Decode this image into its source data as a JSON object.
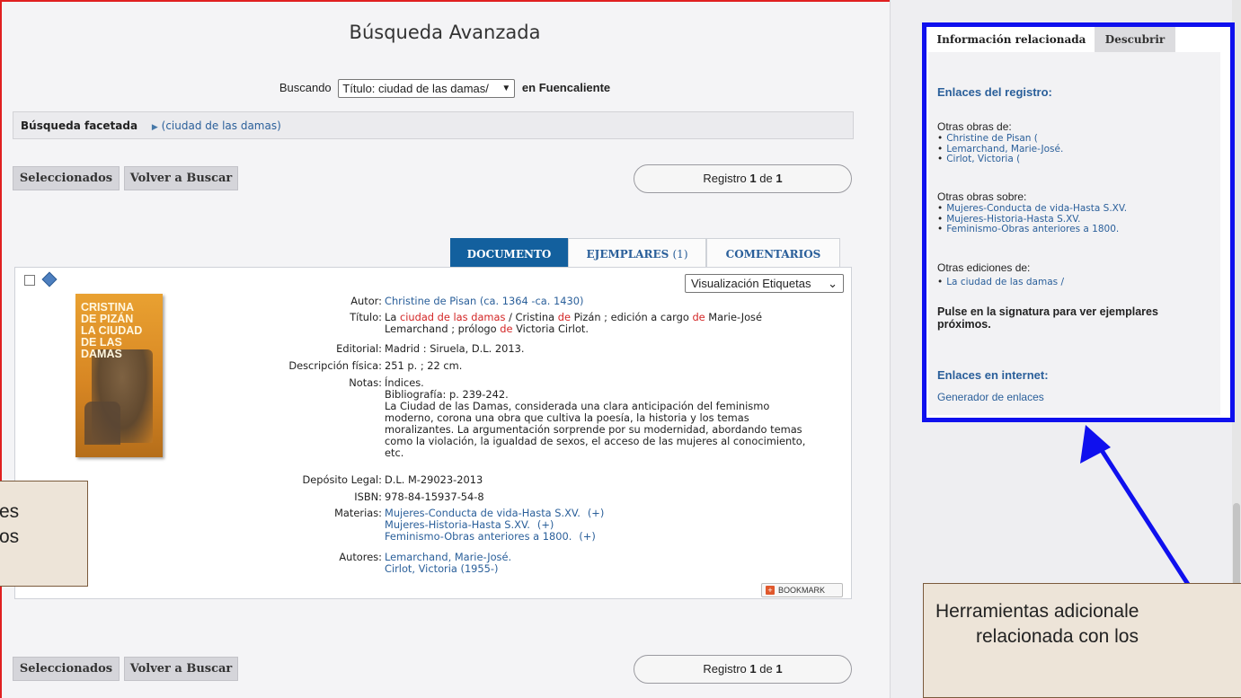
{
  "main": {
    "title": "Búsqueda Avanzada",
    "searching_label": "Buscando",
    "search_select_value": "Título: ciudad de las damas/",
    "search_where": "en Fuencaliente",
    "facet_label": "Búsqueda facetada",
    "facet_crumb": "(ciudad de las damas)",
    "buttons": {
      "selected": "Seleccionados",
      "back_search": "Volver a Buscar"
    },
    "record_counter": {
      "prefix": "Registro",
      "current": "1",
      "sep": "de",
      "total": "1"
    },
    "tabs": {
      "documento": "DOCUMENTO",
      "ejemplares": "EJEMPLARES",
      "ejemplares_count": "(1)",
      "comentarios": "COMENTARIOS"
    },
    "view_select_value": "Visualización Etiquetas",
    "cover_title": [
      "CRISTINA",
      "DE PIZÁN",
      "LA CIUDAD",
      "DE LAS DAMAS"
    ],
    "record": {
      "autor_label": "Autor:",
      "autor_value": "Christine de Pisan (ca. 1364 -ca. 1430)",
      "titulo_label": "Título:",
      "titulo_parts": [
        "La ",
        "ciudad de las damas",
        " / Cristina ",
        "de",
        " Pizán ; edición a cargo ",
        "de",
        " Marie-José"
      ],
      "titulo_line2": "Lemarchand ; prólogo ",
      "titulo_line2_hl": "de",
      "titulo_line2_end": " Victoria Cirlot.",
      "editorial_label": "Editorial:",
      "editorial_value": "Madrid : Siruela, D.L. 2013.",
      "descripcion_label": "Descripción física:",
      "descripcion_value": "251 p. ; 22 cm.",
      "notas_label": "Notas:",
      "notas_lines": [
        "Índices.",
        "Bibliografía: p. 239-242.",
        "La Ciudad de las Damas, considerada una clara anticipación del feminismo",
        "moderno, corona una obra que cultiva la poesía, la historia y los temas",
        "moralizantes. La argumentación sorprende por su modernidad, abordando temas",
        "como la violación, la igualdad de sexos, el acceso de las mujeres al conocimiento,",
        "etc."
      ],
      "deposito_label": "Depósito Legal:",
      "deposito_value": "D.L. M-29023-2013",
      "isbn_label": "ISBN:",
      "isbn_value": "978-84-15937-54-8",
      "materias_label": "Materias:",
      "materias": [
        "Mujeres-Conducta de vida-Hasta S.XV.",
        "Mujeres-Historia-Hasta S.XV.",
        "Feminismo-Obras anteriores a 1800."
      ],
      "plus": "(+)",
      "autores_label": "Autores:",
      "autores": [
        "Lemarchand, Marie-José.",
        "Cirlot, Victoria (1955-)"
      ]
    },
    "bookmark_label": "BOOKMARK"
  },
  "side": {
    "tab_active": "Información relacionada",
    "tab_other": "Descubrir",
    "enlaces_registro": "Enlaces del registro:",
    "otras_obras_de": "Otras obras de:",
    "obras_de": [
      "Christine de Pisan (",
      "Lemarchand, Marie-José.",
      "Cirlot, Victoria ("
    ],
    "otras_obras_sobre": "Otras obras sobre:",
    "obras_sobre": [
      "Mujeres-Conducta de vida-Hasta S.XV.",
      "Mujeres-Historia-Hasta S.XV.",
      "Feminismo-Obras anteriores a 1800."
    ],
    "otras_ediciones_de": "Otras ediciones de:",
    "ediciones": [
      "La ciudad de las damas /"
    ],
    "pulse_text": "Pulse en la signatura para ver ejemplares próximos.",
    "enlaces_internet": "Enlaces en internet:",
    "generador": "Generador de enlaces"
  },
  "annotations": {
    "left_lines": [
      "es",
      "os"
    ],
    "right_lines": [
      "Herramientas adicionale",
      "relacionada con los"
    ]
  },
  "colors": {
    "accent_blue": "#13609e",
    "link_blue": "#2a5f9a",
    "highlight_red": "#d32626",
    "frame_red": "#e02020",
    "panel_blue": "#0f10ee",
    "note_bg": "#ede4d8"
  }
}
